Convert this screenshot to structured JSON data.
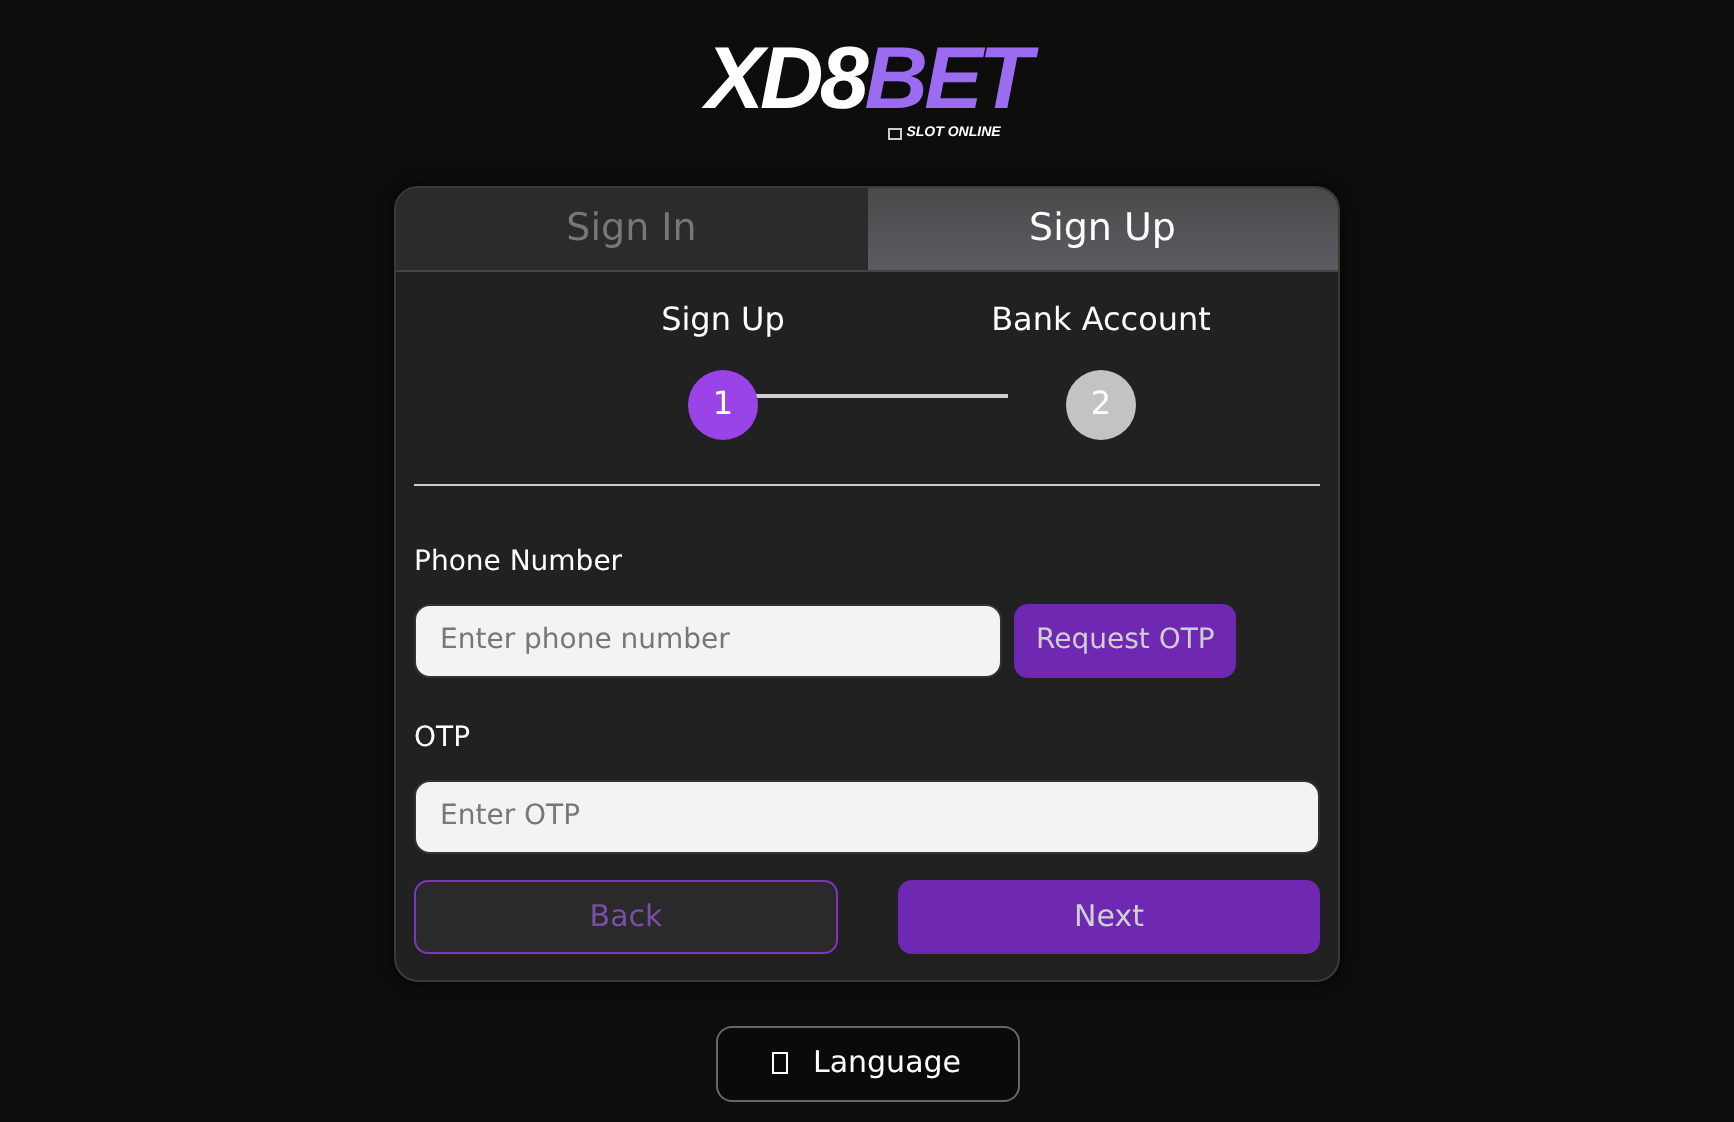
{
  "logo": {
    "main": "XD8",
    "accent": "BET",
    "tagline": "SLOT ONLINE"
  },
  "tabs": [
    {
      "label": "Sign In",
      "selected": false
    },
    {
      "label": "Sign Up",
      "selected": true
    }
  ],
  "steps": [
    {
      "label": "Sign Up",
      "number": "1",
      "selected": true
    },
    {
      "label": "Bank Account",
      "number": "2",
      "selected": false
    }
  ],
  "phone": {
    "label": "Phone Number",
    "placeholder": "Enter phone number",
    "button": "Request OTP"
  },
  "otp": {
    "label": "OTP",
    "placeholder": "Enter OTP"
  },
  "actions": {
    "back": "Back",
    "next": "Next"
  },
  "language": {
    "label": "Language"
  }
}
